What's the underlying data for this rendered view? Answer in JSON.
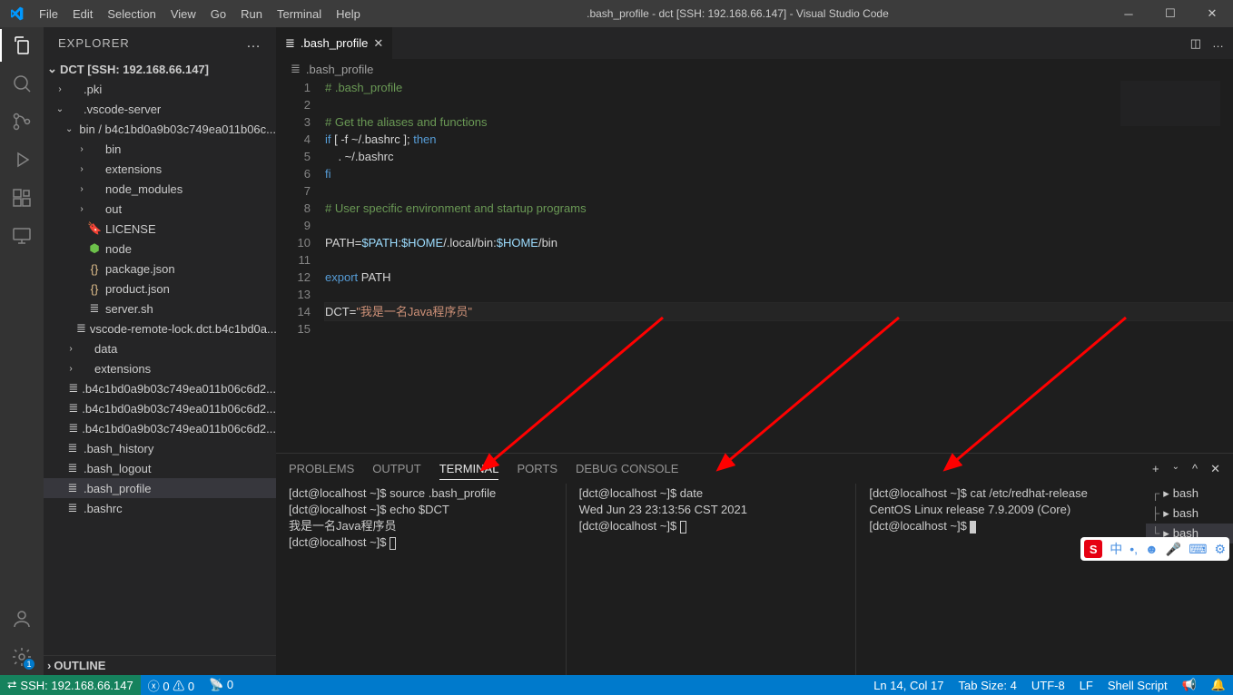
{
  "title": ".bash_profile - dct [SSH: 192.168.66.147] - Visual Studio Code",
  "menu": [
    "File",
    "Edit",
    "Selection",
    "View",
    "Go",
    "Run",
    "Terminal",
    "Help"
  ],
  "explorer": {
    "title": "EXPLORER",
    "root": "DCT [SSH: 192.168.66.147]",
    "outline": "OUTLINE"
  },
  "tree": [
    {
      "depth": 0,
      "chev": "›",
      "icon": "",
      "label": ".pki"
    },
    {
      "depth": 0,
      "chev": "⌄",
      "icon": "",
      "label": ".vscode-server"
    },
    {
      "depth": 1,
      "chev": "⌄",
      "icon": "",
      "label": "bin / b4c1bd0a9b03c749ea011b06c..."
    },
    {
      "depth": 2,
      "chev": "›",
      "icon": "",
      "label": "bin"
    },
    {
      "depth": 2,
      "chev": "›",
      "icon": "",
      "label": "extensions"
    },
    {
      "depth": 2,
      "chev": "›",
      "icon": "",
      "label": "node_modules"
    },
    {
      "depth": 2,
      "chev": "›",
      "icon": "",
      "label": "out"
    },
    {
      "depth": 2,
      "chev": "",
      "icon": "🔖",
      "label": "LICENSE",
      "iconColor": "#e2c08d"
    },
    {
      "depth": 2,
      "chev": "",
      "icon": "⬢",
      "label": "node",
      "iconColor": "#6cc04a"
    },
    {
      "depth": 2,
      "chev": "",
      "icon": "{}",
      "label": "package.json",
      "iconColor": "#e2c08d"
    },
    {
      "depth": 2,
      "chev": "",
      "icon": "{}",
      "label": "product.json",
      "iconColor": "#e2c08d"
    },
    {
      "depth": 2,
      "chev": "",
      "icon": "≣",
      "label": "server.sh"
    },
    {
      "depth": 2,
      "chev": "",
      "icon": "≣",
      "label": "vscode-remote-lock.dct.b4c1bd0a..."
    },
    {
      "depth": 1,
      "chev": "›",
      "icon": "",
      "label": "data"
    },
    {
      "depth": 1,
      "chev": "›",
      "icon": "",
      "label": "extensions"
    },
    {
      "depth": 1,
      "chev": "",
      "icon": "≣",
      "label": ".b4c1bd0a9b03c749ea011b06c6d2..."
    },
    {
      "depth": 1,
      "chev": "",
      "icon": "≣",
      "label": ".b4c1bd0a9b03c749ea011b06c6d2..."
    },
    {
      "depth": 1,
      "chev": "",
      "icon": "≣",
      "label": ".b4c1bd0a9b03c749ea011b06c6d2..."
    },
    {
      "depth": 0,
      "chev": "",
      "icon": "≣",
      "label": ".bash_history"
    },
    {
      "depth": 0,
      "chev": "",
      "icon": "≣",
      "label": ".bash_logout"
    },
    {
      "depth": 0,
      "chev": "",
      "icon": "≣",
      "label": ".bash_profile",
      "selected": true
    },
    {
      "depth": 0,
      "chev": "",
      "icon": "≣",
      "label": ".bashrc"
    }
  ],
  "tab": {
    "label": ".bash_profile"
  },
  "breadcrumb": ".bash_profile",
  "code": {
    "lines": [
      {
        "n": 1,
        "html": "<span class='c-comment'># .bash_profile</span>"
      },
      {
        "n": 2,
        "html": ""
      },
      {
        "n": 3,
        "html": "<span class='c-comment'># Get the aliases and functions</span>"
      },
      {
        "n": 4,
        "html": "<span class='c-keyword'>if</span><span class='c-text'> [ -f ~/.bashrc ]</span><span class='c-punc'>;</span> <span class='c-keyword'>then</span>"
      },
      {
        "n": 5,
        "html": "    <span class='c-text'>. ~/.bashrc</span>"
      },
      {
        "n": 6,
        "html": "<span class='c-keyword'>fi</span>"
      },
      {
        "n": 7,
        "html": ""
      },
      {
        "n": 8,
        "html": "<span class='c-comment'># User specific environment and startup programs</span>"
      },
      {
        "n": 9,
        "html": ""
      },
      {
        "n": 10,
        "html": "<span class='c-text'>PATH=</span><span class='c-var'>$PATH</span><span class='c-punc'>:</span><span class='c-var'>$HOME</span><span class='c-text'>/.local/bin</span><span class='c-punc'>:</span><span class='c-var'>$HOME</span><span class='c-text'>/bin</span>"
      },
      {
        "n": 11,
        "html": ""
      },
      {
        "n": 12,
        "html": "<span class='c-keyword'>export</span><span class='c-text'> PATH</span>"
      },
      {
        "n": 13,
        "html": ""
      },
      {
        "n": 14,
        "html": "<span class='c-text'>DCT=</span><span class='c-str'>\"我是一名Java程序员\"</span>",
        "current": true
      },
      {
        "n": 15,
        "html": ""
      }
    ]
  },
  "panel": {
    "tabs": [
      "PROBLEMS",
      "OUTPUT",
      "TERMINAL",
      "PORTS",
      "DEBUG CONSOLE"
    ],
    "activeTab": "TERMINAL",
    "termList": [
      "bash",
      "bash",
      "bash"
    ],
    "termListPrefix": [
      "┌",
      "├",
      "└"
    ],
    "t1": [
      "[dct@localhost ~]$ source .bash_profile",
      "[dct@localhost ~]$ echo $DCT",
      "我是一名Java程序员",
      "[dct@localhost ~]$ "
    ],
    "t2": [
      "[dct@localhost ~]$ date",
      "Wed Jun 23 23:13:56 CST 2021",
      "[dct@localhost ~]$ "
    ],
    "t3": [
      "[dct@localhost ~]$ cat /etc/redhat-release",
      "CentOS Linux release 7.9.2009 (Core)",
      "[dct@localhost ~]$ "
    ]
  },
  "status": {
    "remote": "SSH: 192.168.66.147",
    "errors": "0",
    "warnings": "0",
    "ports": "0",
    "lncol": "Ln 14, Col 17",
    "tabsize": "Tab Size: 4",
    "encoding": "UTF-8",
    "eol": "LF",
    "lang": "Shell Script"
  },
  "ime": {
    "zhong": "中"
  }
}
